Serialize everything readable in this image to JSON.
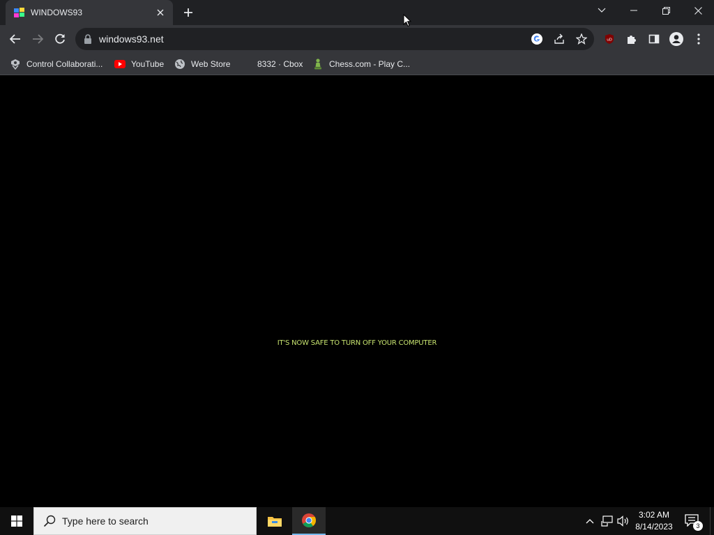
{
  "browser": {
    "tab": {
      "title": "WINDOWS93"
    },
    "omnibox": {
      "url": "windows93.net"
    },
    "bookmarks": [
      {
        "label": "Control Collaborati...",
        "icon": "control-collab-icon"
      },
      {
        "label": "YouTube",
        "icon": "youtube-icon"
      },
      {
        "label": "Web Store",
        "icon": "web-store-icon"
      },
      {
        "label": "8332 · Cbox",
        "icon": ""
      },
      {
        "label": "Chess.com - Play C...",
        "icon": "chess-icon"
      }
    ]
  },
  "page": {
    "message": "IT'S NOW SAFE TO TURN OFF YOUR COMPUTER",
    "message_color": "#c7e36f"
  },
  "taskbar": {
    "search_placeholder": "Type here to search",
    "clock": {
      "time": "3:02 AM",
      "date": "8/14/2023"
    },
    "notification_count": "3"
  },
  "colors": {
    "tab_bg": "#35363a",
    "titlebar_bg": "#202124",
    "omnibox_bg": "#202124",
    "taskbar_bg": "#101010",
    "accent": "#76b9ed"
  }
}
